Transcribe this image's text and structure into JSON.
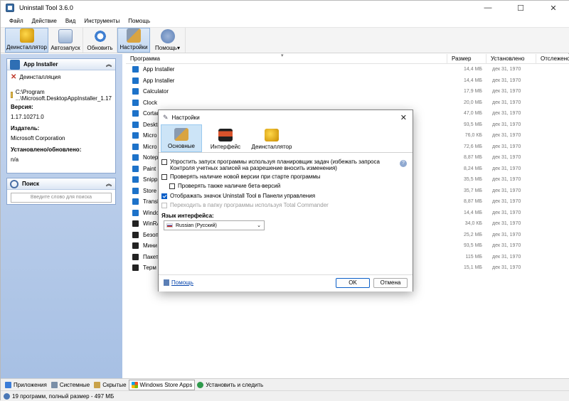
{
  "window": {
    "title": "Uninstall Tool 3.6.0",
    "min_glyph": "—",
    "max_glyph": "☐",
    "close_glyph": "✕"
  },
  "menu": [
    "Файл",
    "Действие",
    "Вид",
    "Инструменты",
    "Помощь"
  ],
  "toolbar": {
    "uninstaller": "Деинсталлятор",
    "autorun": "Автозапуск",
    "refresh": "Обновить",
    "settings": "Настройки",
    "help": "Помощь",
    "help_arrow": "▾"
  },
  "sidebar": {
    "app_panel_title": "App Installer",
    "uninstall_link": "Деинсталляция",
    "path_line1": "C:\\Program",
    "path_line2": "...\\Microsoft.DesktopAppInstaller_1.17",
    "version_label": "Версия:",
    "version_value": "1.17.10271.0",
    "publisher_label": "Издатель:",
    "publisher_value": "Microsoft Corporation",
    "installed_label": "Установлено/обновлено:",
    "installed_value": "n/a",
    "search_panel_title": "Поиск",
    "search_placeholder": "Введите слово для поиска",
    "collapse_glyph": "︽"
  },
  "list": {
    "columns": [
      "Программа",
      "Размер",
      "Установлено",
      "Отслежено"
    ],
    "sort_glyph": "▾",
    "rows": [
      {
        "name": "App Installer",
        "size": "14,4 МБ",
        "date": "дек 31, 1970"
      },
      {
        "name": "App Installer",
        "size": "14,4 МБ",
        "date": "дек 31, 1970"
      },
      {
        "name": "Calculator",
        "size": "17,9 МБ",
        "date": "дек 31, 1970"
      },
      {
        "name": "Clock",
        "size": "20,0 МБ",
        "date": "дек 31, 1970"
      },
      {
        "name": "Cortan",
        "size": "47,0 МБ",
        "date": "дек 31, 1970"
      },
      {
        "name": "Deskto",
        "size": "93,5 МБ",
        "date": "дек 31, 1970"
      },
      {
        "name": "Micro",
        "size": "76,0 КБ",
        "date": "дек 31, 1970"
      },
      {
        "name": "Micro",
        "size": "72,6 МБ",
        "date": "дек 31, 1970"
      },
      {
        "name": "Notep",
        "size": "8,87 МБ",
        "date": "дек 31, 1970"
      },
      {
        "name": "Paint",
        "size": "8,24 МБ",
        "date": "дек 31, 1970"
      },
      {
        "name": "Snippi",
        "size": "35,5 МБ",
        "date": "дек 31, 1970"
      },
      {
        "name": "Store",
        "size": "35,7 МБ",
        "date": "дек 31, 1970"
      },
      {
        "name": "Transl",
        "size": "8,87 МБ",
        "date": "дек 31, 1970"
      },
      {
        "name": "Windo",
        "size": "14,4 МБ",
        "date": "дек 31, 1970"
      },
      {
        "name": "WinRA",
        "size": "34,0 КБ",
        "date": "дек 31, 1970"
      },
      {
        "name": "Безоп",
        "size": "25,2 МБ",
        "date": "дек 31, 1970"
      },
      {
        "name": "Мини",
        "size": "93,5 МБ",
        "date": "дек 31, 1970"
      },
      {
        "name": "Пакет",
        "size": "115 МБ",
        "date": "дек 31, 1970"
      },
      {
        "name": "Терм",
        "size": "15,1 МБ",
        "date": "дек 31, 1970"
      }
    ]
  },
  "bottom_tabs": [
    "Приложения",
    "Системные",
    "Скрытые",
    "Windows Store Apps",
    "Установить и следить"
  ],
  "status": "19 программ, полный размер - 497 МБ",
  "dialog": {
    "title": "Настройки",
    "close_glyph": "✕",
    "tabs": [
      "Основные",
      "Интерфейс",
      "Деинсталлятор"
    ],
    "opt1_line1": "Упростить запуск программы используя планировщик задач (избежать запроса",
    "opt1_line2": "Контроля учетных записей на разрешение вносить изменения)",
    "opt2": "Проверять наличие новой версии при старте программы",
    "opt3": "Проверять также наличие бета-версий",
    "opt4": "Отображать значок Uninstall Tool в Панели управления",
    "opt5": "Переходить в папку программы используя Total Commander",
    "help_glyph": "?",
    "lang_label": "Язык интерфейса:",
    "lang_value": "Russian (Русский)",
    "select_arrow": "⌄",
    "help_link": "Помощь",
    "ok": "OK",
    "cancel": "Отмена"
  }
}
